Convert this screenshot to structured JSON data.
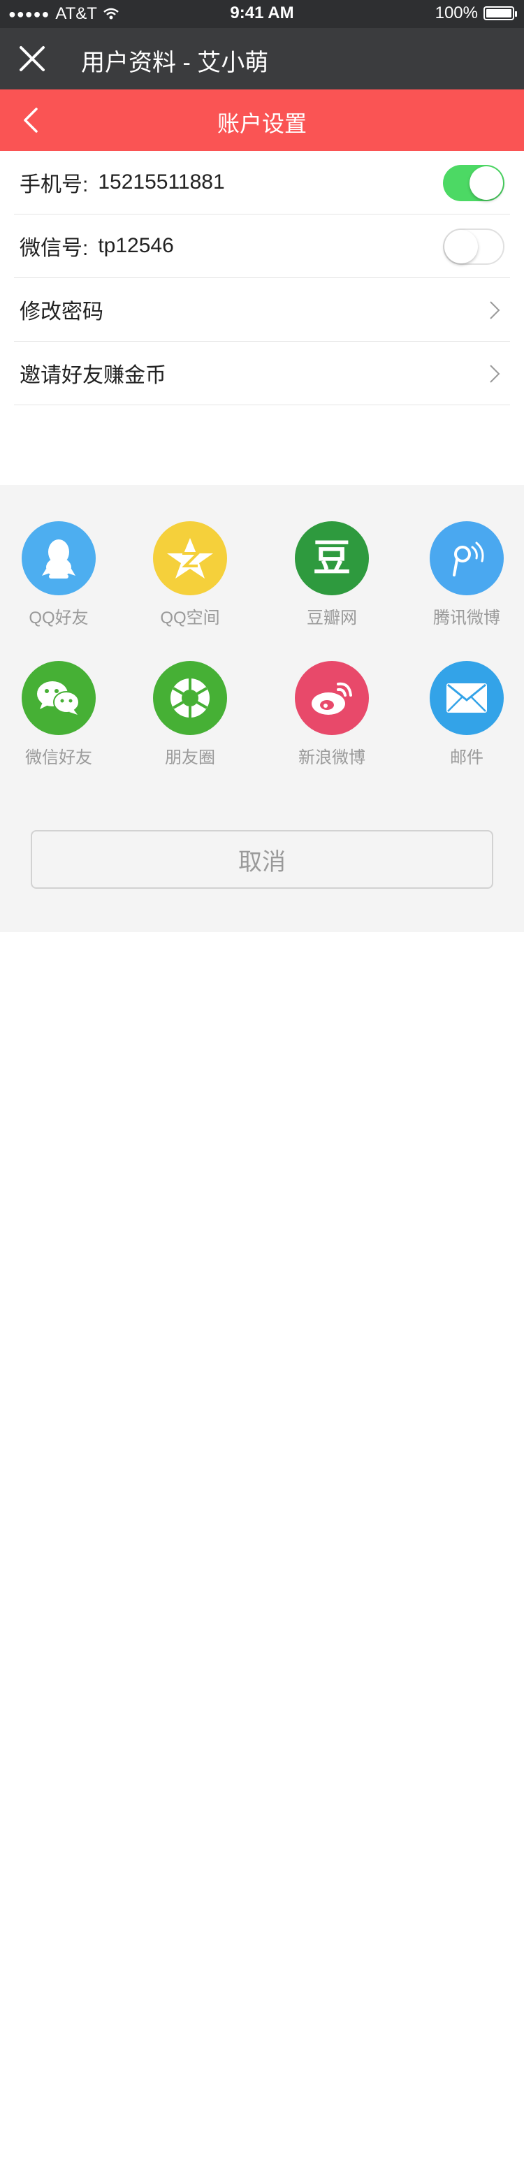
{
  "status_bar": {
    "carrier": "AT&T",
    "time": "9:41 AM",
    "battery": "100%"
  },
  "title_bar": {
    "title": "用户资料 - 艾小萌"
  },
  "header": {
    "title": "账户设置"
  },
  "settings": {
    "phone": {
      "label": "手机号:",
      "value": "15215511881",
      "toggle_on": true
    },
    "wechat": {
      "label": "微信号:",
      "value": "tp12546",
      "toggle_on": false
    },
    "change_password": {
      "label": "修改密码"
    },
    "invite_friends": {
      "label": "邀请好友赚金币"
    }
  },
  "share": {
    "items": [
      {
        "label": "QQ好友",
        "icon": "qq-icon",
        "color": "#4daef0"
      },
      {
        "label": "QQ空间",
        "icon": "qzone-icon",
        "color": "#f5d03b"
      },
      {
        "label": "豆瓣网",
        "icon": "douban-icon",
        "color": "#2e9a3e"
      },
      {
        "label": "腾讯微博",
        "icon": "tencent-weibo-icon",
        "color": "#4aa8f0"
      },
      {
        "label": "微信好友",
        "icon": "wechat-icon",
        "color": "#46b035"
      },
      {
        "label": "朋友圈",
        "icon": "moments-icon",
        "color": "#46b035"
      },
      {
        "label": "新浪微博",
        "icon": "sina-weibo-icon",
        "color": "#e8496a"
      },
      {
        "label": "邮件",
        "icon": "mail-icon",
        "color": "#33a3e8"
      }
    ],
    "douban_glyph": "豆",
    "cancel_label": "取消"
  },
  "colors": {
    "header_red": "#fa5454",
    "title_bar": "#3b3c3e",
    "toggle_green": "#4cd964"
  }
}
